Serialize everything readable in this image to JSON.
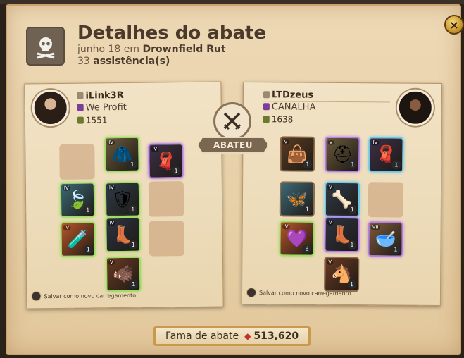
{
  "header": {
    "title": "Detalhes do abate",
    "date_prefix": "junho 18 em",
    "location": "Drownfield Rut",
    "assist_count": "33",
    "assist_label": "assistência(s)"
  },
  "close_icon": "×",
  "badge": "ABATEU",
  "killer": {
    "name": "iLink3R",
    "guild": "We Profit",
    "ip": "1551",
    "save_label": "Salvar como novo carregamento"
  },
  "victim": {
    "name": "LTDzeus",
    "guild": "CANALHA",
    "ip": "1638",
    "save_label": "Salvar como novo carregamento"
  },
  "footer": {
    "fame_label": "Fama de abate",
    "fame_value": "513,620"
  },
  "killer_slots": [
    {
      "icon": "bag-icon",
      "glyph": "",
      "qty": "",
      "tier": "",
      "empty": true
    },
    {
      "icon": "head-armor-icon",
      "glyph": "🧥",
      "qty": "1",
      "tier": "IV",
      "empty": false,
      "frame": "green"
    },
    {
      "icon": "cape-icon",
      "glyph": "🧣",
      "qty": "1",
      "tier": "IV",
      "empty": false,
      "frame": "purple"
    },
    {
      "icon": "offhand-icon",
      "glyph": "🍃",
      "qty": "1",
      "tier": "IV",
      "empty": false,
      "frame": "green"
    },
    {
      "icon": "chest-armor-icon",
      "glyph": "🛡",
      "qty": "1",
      "tier": "IV",
      "empty": false,
      "frame": "green"
    },
    {
      "icon": "weapon-icon",
      "glyph": "",
      "qty": "",
      "tier": "",
      "empty": true
    },
    {
      "icon": "potion-icon",
      "glyph": "🧪",
      "qty": "1",
      "tier": "IV",
      "empty": false,
      "frame": "green"
    },
    {
      "icon": "boots-icon",
      "glyph": "👢",
      "qty": "1",
      "tier": "IV",
      "empty": false,
      "frame": "green"
    },
    {
      "icon": "food-icon",
      "glyph": "",
      "qty": "",
      "tier": "",
      "empty": true
    },
    {
      "icon": "mount-icon",
      "glyph": "🐗",
      "qty": "1",
      "tier": "V",
      "empty": false,
      "frame": "green"
    }
  ],
  "victim_slots": [
    {
      "icon": "bag-icon",
      "glyph": "👜",
      "qty": "1",
      "tier": "V",
      "empty": false,
      "frame": "none"
    },
    {
      "icon": "head-armor-icon",
      "glyph": "⛑",
      "qty": "1",
      "tier": "V",
      "empty": false,
      "frame": "purple"
    },
    {
      "icon": "cape-icon",
      "glyph": "🧣",
      "qty": "1",
      "tier": "IV",
      "empty": false,
      "frame": "blue"
    },
    {
      "icon": "offhand-icon",
      "glyph": "🦋",
      "qty": "1",
      "tier": "",
      "empty": false,
      "frame": "none"
    },
    {
      "icon": "chest-armor-icon",
      "glyph": "🦴",
      "qty": "1",
      "tier": "V",
      "empty": false,
      "frame": "blue"
    },
    {
      "icon": "weapon-icon",
      "glyph": "",
      "qty": "",
      "tier": "",
      "empty": true
    },
    {
      "icon": "potion-icon",
      "glyph": "💜",
      "qty": "6",
      "tier": "IV",
      "empty": false,
      "frame": "green"
    },
    {
      "icon": "boots-icon",
      "glyph": "👢",
      "qty": "1",
      "tier": "V",
      "empty": false,
      "frame": "purple"
    },
    {
      "icon": "food-icon",
      "glyph": "🥣",
      "qty": "1",
      "tier": "VII",
      "empty": false,
      "frame": "purple"
    },
    {
      "icon": "mount-icon",
      "glyph": "🐴",
      "qty": "1",
      "tier": "V",
      "empty": false,
      "frame": "none"
    }
  ]
}
